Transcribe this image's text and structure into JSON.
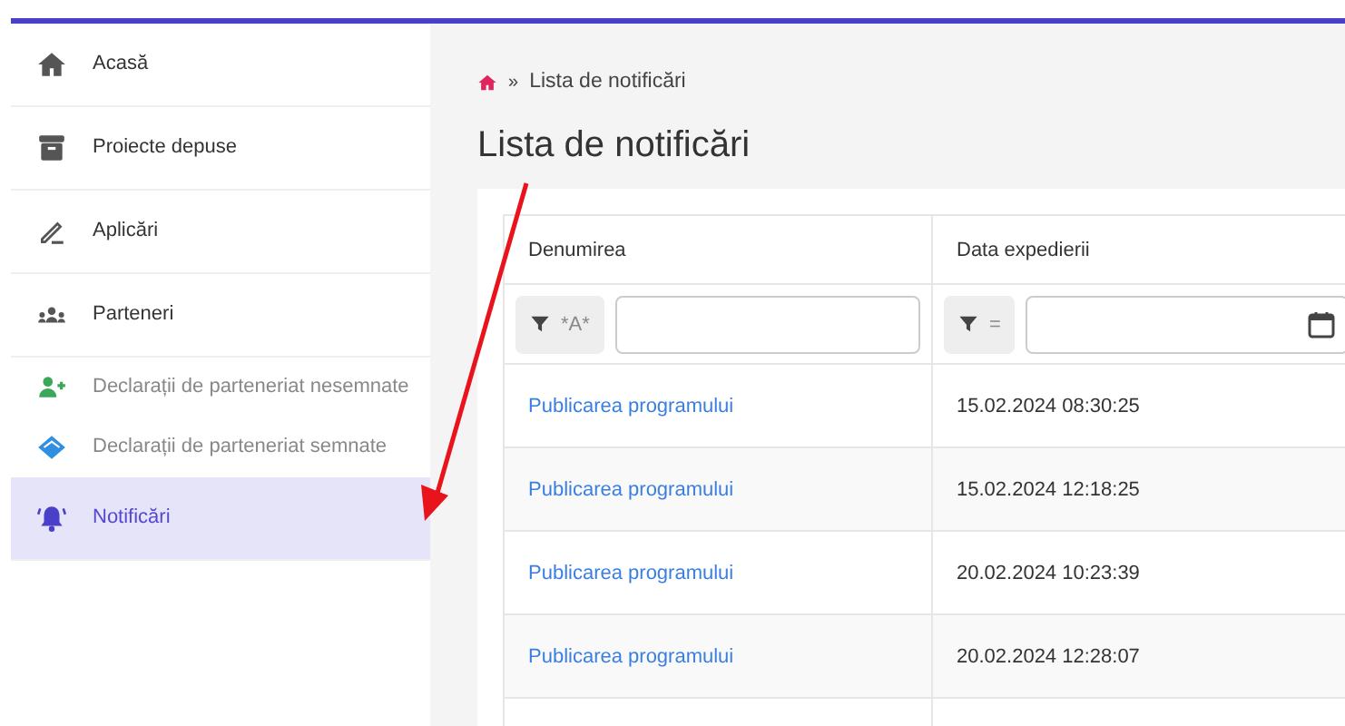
{
  "sidebar": {
    "items": [
      {
        "label": "Acasă",
        "kind": "main",
        "selected": false
      },
      {
        "label": "Proiecte depuse",
        "kind": "main",
        "selected": false
      },
      {
        "label": "Aplicări",
        "kind": "main",
        "selected": false
      },
      {
        "label": "Parteneri",
        "kind": "main",
        "selected": false
      },
      {
        "label": "Declarații de parteneriat nesemnate",
        "kind": "sub",
        "selected": false
      },
      {
        "label": "Declarații de parteneriat semnate",
        "kind": "sub",
        "selected": false
      },
      {
        "label": "Notificări",
        "kind": "main",
        "selected": true
      }
    ]
  },
  "breadcrumb": {
    "separator": "»",
    "current": "Lista de notificări"
  },
  "page_title": "Lista de notificări",
  "table": {
    "columns": [
      {
        "label": "Denumirea",
        "filter_operator": "*A*"
      },
      {
        "label": "Data expedierii",
        "filter_operator": "="
      }
    ],
    "rows": [
      {
        "name": "Publicarea programului",
        "date": "15.02.2024 08:30:25"
      },
      {
        "name": "Publicarea programului",
        "date": "15.02.2024 12:18:25"
      },
      {
        "name": "Publicarea programului",
        "date": "20.02.2024 10:23:39"
      },
      {
        "name": "Publicarea programului",
        "date": "20.02.2024 12:28:07"
      }
    ]
  }
}
